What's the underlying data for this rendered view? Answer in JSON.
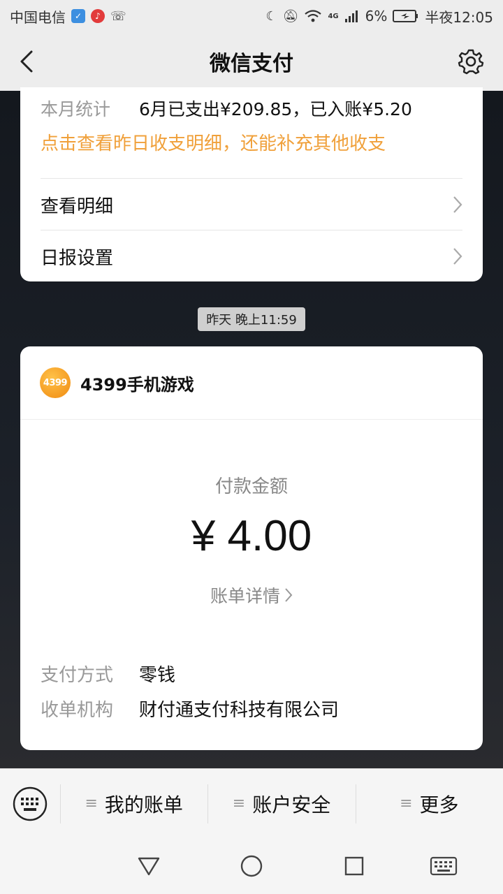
{
  "status_bar": {
    "carrier": "中国电信",
    "battery_percent": "6%",
    "time": "半夜12:05",
    "network": "4G"
  },
  "header": {
    "title": "微信支付"
  },
  "summary_card": {
    "stat_label": "本月统计",
    "stat_value": "6月已支出¥209.85，已入账¥5.20",
    "stat_link": "点击查看昨日收支明细，还能补充其他收支",
    "menu": [
      {
        "label": "查看明细"
      },
      {
        "label": "日报设置"
      }
    ]
  },
  "timestamp": "昨天 晚上11:59",
  "payment_card": {
    "merchant_logo_text": "4399",
    "merchant_name": "4399手机游戏",
    "amount_label": "付款金额",
    "amount": "¥ 4.00",
    "detail_link": "账单详情",
    "info": [
      {
        "label": "支付方式",
        "value": "零钱"
      },
      {
        "label": "收单机构",
        "value": "财付通支付科技有限公司"
      }
    ]
  },
  "bottom_menu": {
    "tabs": [
      {
        "label": "我的账单"
      },
      {
        "label": "账户安全"
      },
      {
        "label": "更多"
      }
    ]
  },
  "colors": {
    "accent_orange": "#f0a03a",
    "bar_bg": "#ededed",
    "card_bg": "#ffffff"
  }
}
